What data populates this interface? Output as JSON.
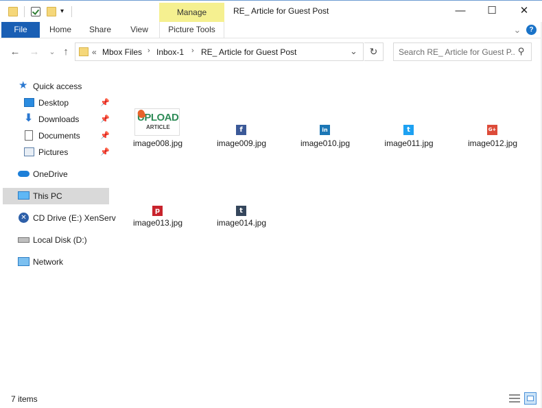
{
  "title_bar": {
    "manage_label": "Manage",
    "window_title": "RE_ Article for Guest Post",
    "minimize": "—",
    "maximize": "☐",
    "close": "✕"
  },
  "ribbon": {
    "tabs": [
      {
        "label": "File"
      },
      {
        "label": "Home"
      },
      {
        "label": "Share"
      },
      {
        "label": "View"
      },
      {
        "label": "Picture Tools"
      }
    ],
    "expand_icon": "⌄",
    "help_icon": "?"
  },
  "address_bar": {
    "overflow": "«",
    "breadcrumbs": [
      "Mbox Files",
      "Inbox-1",
      "RE_ Article for Guest Post"
    ],
    "separator": "›",
    "dropdown": "⌄",
    "refresh": "↻"
  },
  "search": {
    "placeholder": "Search RE_ Article for Guest P...",
    "icon": "⚲"
  },
  "nav": {
    "back": "←",
    "forward": "→",
    "recent": "⌄",
    "up": "↑"
  },
  "sidebar": {
    "items": [
      {
        "label": "Quick access",
        "icon": "star-icon"
      },
      {
        "label": "Desktop",
        "icon": "desktop-icon",
        "pinned": true
      },
      {
        "label": "Downloads",
        "icon": "download-icon",
        "pinned": true
      },
      {
        "label": "Documents",
        "icon": "document-icon",
        "pinned": true
      },
      {
        "label": "Pictures",
        "icon": "pictures-icon",
        "pinned": true
      },
      {
        "label": "OneDrive",
        "icon": "cloud-icon"
      },
      {
        "label": "This PC",
        "icon": "computer-icon",
        "selected": true
      },
      {
        "label": "CD Drive (E:) XenServ",
        "icon": "cd-drive-icon"
      },
      {
        "label": "Local Disk (D:)",
        "icon": "disk-icon"
      },
      {
        "label": "Network",
        "icon": "network-icon"
      }
    ],
    "pin_glyph": "⚲"
  },
  "files": [
    {
      "name": "image008.jpg",
      "kind": "upload-article-logo",
      "logo_text_1": "UPLOAD",
      "logo_text_2": "ARTICLE"
    },
    {
      "name": "image009.jpg",
      "kind": "facebook",
      "glyph": "f",
      "color": "#3b5998"
    },
    {
      "name": "image010.jpg",
      "kind": "linkedin",
      "glyph": "in",
      "color": "#1b76b5"
    },
    {
      "name": "image011.jpg",
      "kind": "twitter",
      "glyph": "t",
      "color": "#1da1f2"
    },
    {
      "name": "image012.jpg",
      "kind": "google-plus",
      "glyph": "G+",
      "color": "#dd4b39"
    },
    {
      "name": "image013.jpg",
      "kind": "pinterest",
      "glyph": "p",
      "color": "#c8232c"
    },
    {
      "name": "image014.jpg",
      "kind": "tumblr",
      "glyph": "t",
      "color": "#35465c"
    }
  ],
  "status_bar": {
    "item_count": "7 items"
  },
  "colors": {
    "file_tab": "#1a5fb4",
    "manage_tab": "#f5f090",
    "selected_nav": "#d9d9d9"
  }
}
